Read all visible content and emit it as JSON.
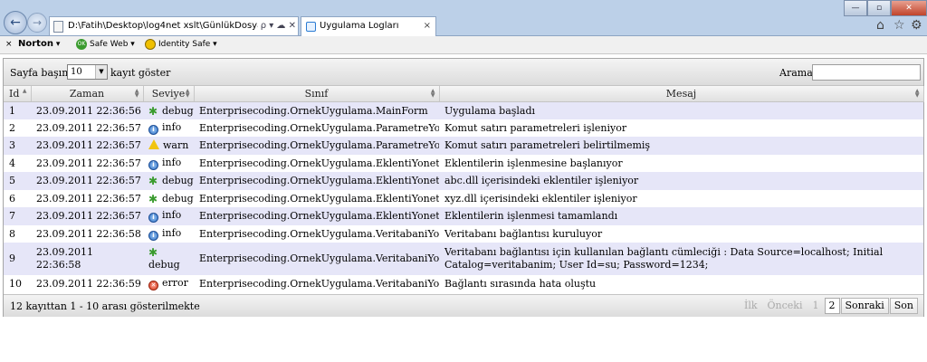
{
  "browser": {
    "address": "D:\\Fatih\\Desktop\\log4net xslt\\GünlükDosyası.xml",
    "address_buttons": "ρ ▾ ☁ ✕",
    "tab_title": "Uygulama Logları",
    "tab_close": "×",
    "back": "←",
    "forward": "→",
    "min": "—",
    "max": "▫",
    "close": "✕",
    "home": "⌂",
    "star": "☆",
    "gear": "⚙"
  },
  "toolbar": {
    "close": "×",
    "norton": "Norton",
    "norton_arrow": "▾",
    "safe_web": "Safe Web",
    "identity_safe": "Identity Safe"
  },
  "grid": {
    "per_page_label": "Sayfa başına",
    "per_page_value": "10",
    "per_page_suffix": "kayıt göster",
    "search_label": "Arama :",
    "search_value": "",
    "columns": {
      "id": "Id",
      "time": "Zaman",
      "level": "Seviye",
      "class": "Sınıf",
      "message": "Mesaj"
    },
    "rows": [
      {
        "id": "1",
        "time": "23.09.2011 22:36:56",
        "level": "debug",
        "class": "Enterprisecoding.OrnekUygulama.MainForm",
        "message": "Uygulama başladı"
      },
      {
        "id": "2",
        "time": "23.09.2011 22:36:57",
        "level": "info",
        "class": "Enterprisecoding.OrnekUygulama.ParametreYoneticisi",
        "message": "Komut satırı parametreleri işleniyor"
      },
      {
        "id": "3",
        "time": "23.09.2011 22:36:57",
        "level": "warn",
        "class": "Enterprisecoding.OrnekUygulama.ParametreYoneticisi",
        "message": "Komut satırı parametreleri belirtilmemiş"
      },
      {
        "id": "4",
        "time": "23.09.2011 22:36:57",
        "level": "info",
        "class": "Enterprisecoding.OrnekUygulama.EklentiYoneticisi",
        "message": "Eklentilerin işlenmesine başlanıyor"
      },
      {
        "id": "5",
        "time": "23.09.2011 22:36:57",
        "level": "debug",
        "class": "Enterprisecoding.OrnekUygulama.EklentiYoneticisi",
        "message": "abc.dll içerisindeki eklentiler işleniyor"
      },
      {
        "id": "6",
        "time": "23.09.2011 22:36:57",
        "level": "debug",
        "class": "Enterprisecoding.OrnekUygulama.EklentiYoneticisi",
        "message": "xyz.dll içerisindeki eklentiler işleniyor"
      },
      {
        "id": "7",
        "time": "23.09.2011 22:36:57",
        "level": "info",
        "class": "Enterprisecoding.OrnekUygulama.EklentiYoneticisi",
        "message": "Eklentilerin işlenmesi tamamlandı"
      },
      {
        "id": "8",
        "time": "23.09.2011 22:36:58",
        "level": "info",
        "class": "Enterprisecoding.OrnekUygulama.VeritabaniYoneticisi",
        "message": "Veritabanı bağlantısı kuruluyor"
      },
      {
        "id": "9",
        "time": "23.09.2011 22:36:58",
        "level": "debug",
        "class": "Enterprisecoding.OrnekUygulama.VeritabaniYoneticisi",
        "message": "Veritabanı bağlantısı için kullanılan bağlantı cümleciği : Data Source=localhost; Initial Catalog=veritabanim; User Id=su; Password=1234;"
      },
      {
        "id": "10",
        "time": "23.09.2011 22:36:59",
        "level": "error",
        "class": "Enterprisecoding.OrnekUygulama.VeritabaniYoneticisi",
        "message": "Bağlantı sırasında hata oluştu"
      }
    ],
    "info": "12 kayıttan 1 - 10 arası gösterilmekte",
    "pager": {
      "first": "İlk",
      "prev": "Önceki",
      "page1": "1",
      "page2": "2",
      "next": "Sonraki",
      "last": "Son"
    }
  }
}
